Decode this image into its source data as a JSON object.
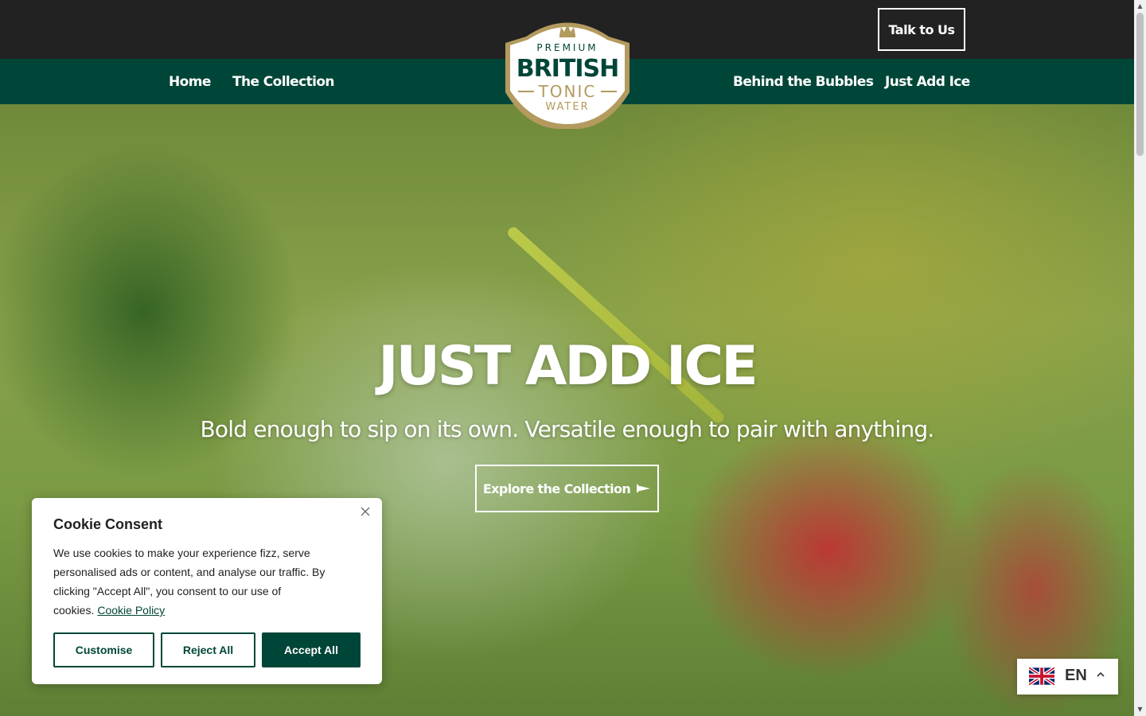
{
  "header": {
    "talk_button": "Talk to Us"
  },
  "logo": {
    "line1": "PREMIUM",
    "line2": "BRITISH",
    "line3": "TONIC",
    "line4": "WATER"
  },
  "nav": {
    "items": [
      {
        "label": "Home"
      },
      {
        "label": "The Collection"
      },
      {
        "label": "Behind the Bubbles"
      },
      {
        "label": "Just Add Ice"
      }
    ]
  },
  "hero": {
    "title": "JUST ADD ICE",
    "subtitle": "Bold enough to sip on its own. Versatile enough to pair with anything.",
    "cta_label": "Explore the Collection"
  },
  "cookie": {
    "title": "Cookie Consent",
    "body": "We use cookies to make your experience fizz, serve personalised ads or content, and analyse our traffic. By clicking \"Accept All\", you consent to our use of cookies.",
    "policy_link": "Cookie Policy",
    "buttons": {
      "customise": "Customise",
      "reject": "Reject All",
      "accept": "Accept All"
    }
  },
  "language": {
    "code": "EN",
    "flag_icon": "uk-flag-icon"
  },
  "colors": {
    "brand_green": "#004638",
    "top_bar": "#222222",
    "logo_gold": "#b39a5e"
  }
}
